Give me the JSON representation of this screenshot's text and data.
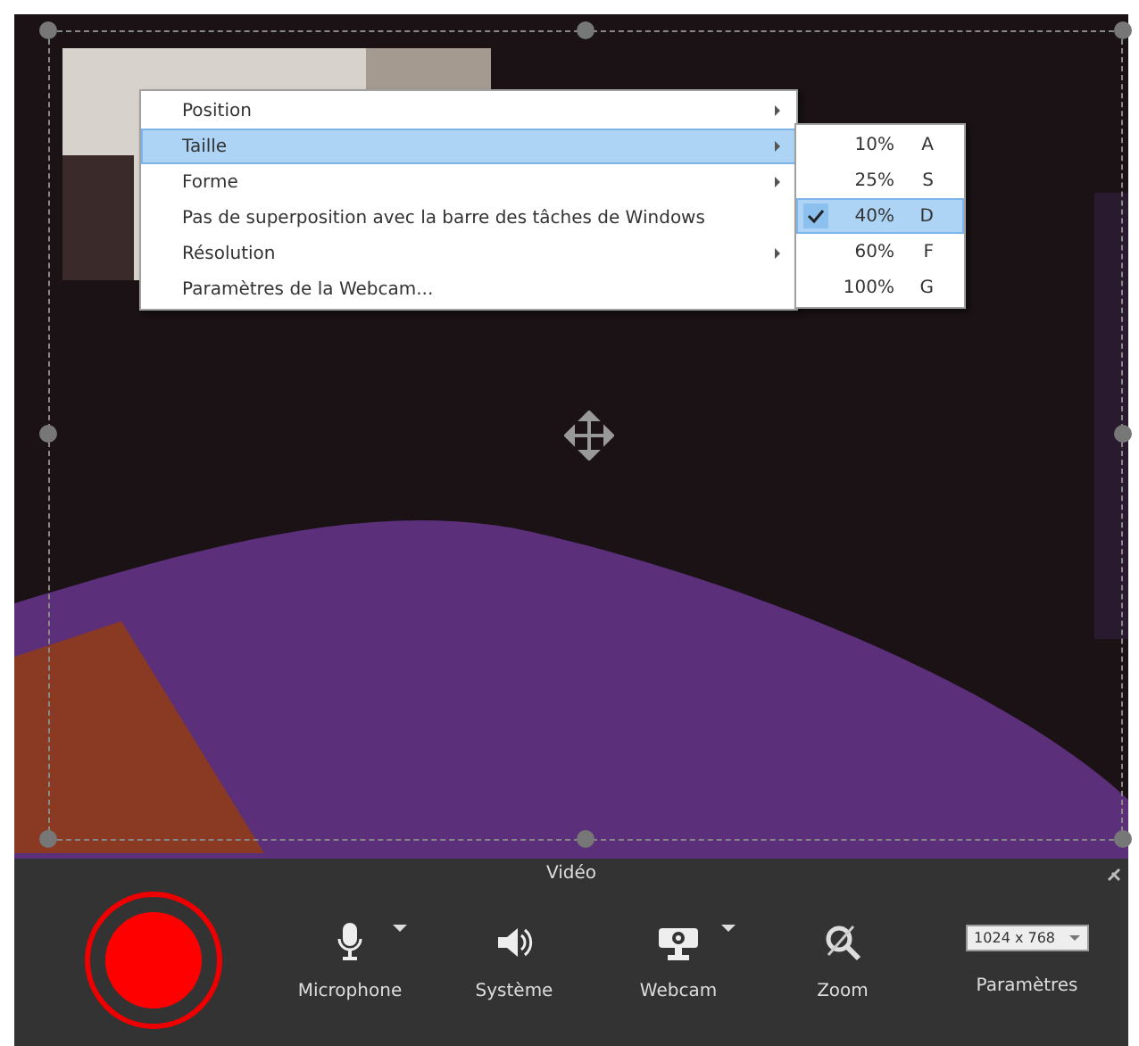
{
  "context_menu": {
    "items": [
      {
        "label": "Position",
        "has_submenu": true,
        "selected": false
      },
      {
        "label": "Taille",
        "has_submenu": true,
        "selected": true
      },
      {
        "label": "Forme",
        "has_submenu": true,
        "selected": false
      },
      {
        "label": "Pas de superposition avec la barre des tâches de Windows",
        "has_submenu": false,
        "selected": false
      },
      {
        "label": "Résolution",
        "has_submenu": true,
        "selected": false
      },
      {
        "label": "Paramètres de la Webcam...",
        "has_submenu": false,
        "selected": false
      }
    ]
  },
  "size_submenu": {
    "items": [
      {
        "label": "10%",
        "key": "A",
        "selected": false,
        "checked": false
      },
      {
        "label": "25%",
        "key": "S",
        "selected": false,
        "checked": false
      },
      {
        "label": "40%",
        "key": "D",
        "selected": true,
        "checked": true
      },
      {
        "label": "60%",
        "key": "F",
        "selected": false,
        "checked": false
      },
      {
        "label": "100%",
        "key": "G",
        "selected": false,
        "checked": false
      }
    ]
  },
  "toolbar": {
    "title": "Vidéo",
    "buttons": [
      {
        "kind": "mic",
        "label": "Microphone",
        "has_dropdown": true
      },
      {
        "kind": "speaker",
        "label": "Système",
        "has_dropdown": false
      },
      {
        "kind": "webcam",
        "label": "Webcam",
        "has_dropdown": true
      },
      {
        "kind": "zoom",
        "label": "Zoom",
        "has_dropdown": false
      }
    ],
    "resolution": {
      "value": "1024 x 768",
      "label": "Paramètres"
    }
  }
}
